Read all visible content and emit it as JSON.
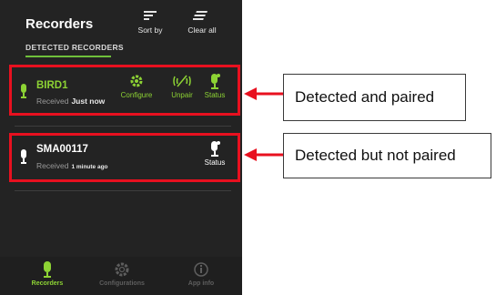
{
  "header": {
    "title": "Recorders",
    "sort_label": "Sort by",
    "clear_label": "Clear all",
    "section_label": "DETECTED RECORDERS"
  },
  "recorders": [
    {
      "name": "BIRD1",
      "received_label": "Received",
      "received_time": "Just now",
      "paired": true,
      "actions": {
        "configure": "Configure",
        "unpair": "Unpair",
        "status": "Status"
      }
    },
    {
      "name": "SMA00117",
      "received_label": "Received",
      "received_time": "1 minute ago",
      "paired": false,
      "actions": {
        "status": "Status"
      }
    }
  ],
  "bottom_nav": [
    {
      "label": "Recorders",
      "icon": "mic-icon",
      "active": true
    },
    {
      "label": "Configurations",
      "icon": "gear-icon",
      "active": false
    },
    {
      "label": "App info",
      "icon": "info-icon",
      "active": false
    }
  ],
  "annotations": {
    "paired": "Detected and paired",
    "not_paired": "Detected but not paired"
  },
  "colors": {
    "background": "#232323",
    "accent_green": "#8dd334",
    "highlight_red": "#e8101f"
  }
}
